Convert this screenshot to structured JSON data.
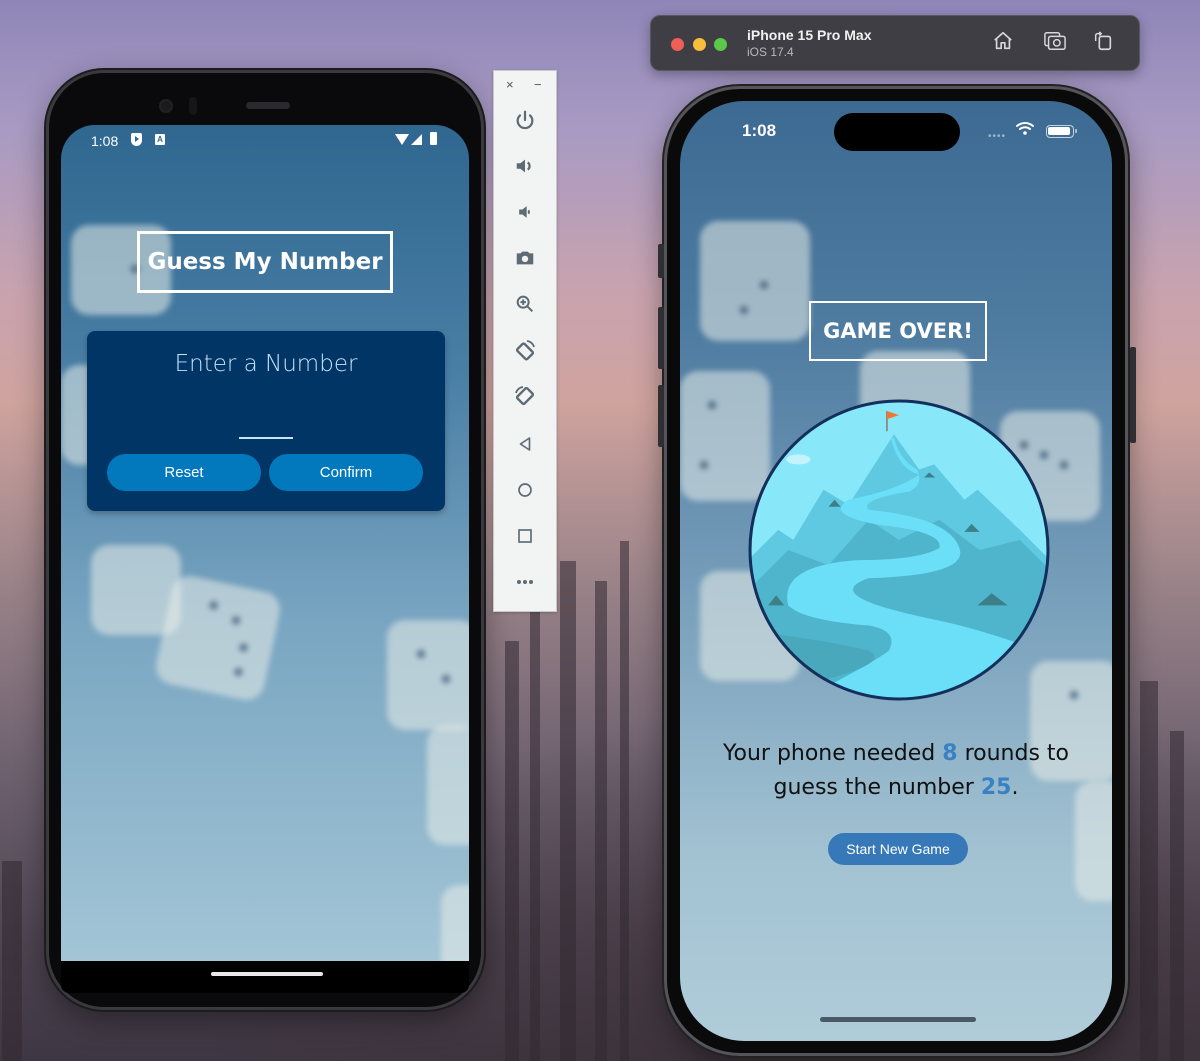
{
  "android_emulator": {
    "status_bar": {
      "time": "1:08",
      "left_icons": [
        "play-protect-icon",
        "keyboard-a-icon"
      ],
      "right_icons": [
        "wifi-icon",
        "signal-icon",
        "battery-icon"
      ],
      "a_glyph": "A"
    },
    "screen": {
      "title": "Guess My Number",
      "card": {
        "label": "Enter a Number",
        "input_value": "",
        "reset_label": "Reset",
        "confirm_label": "Confirm"
      }
    }
  },
  "emulator_toolbar": {
    "close_label": "×",
    "minimize_label": "−",
    "buttons": [
      {
        "name": "power-icon",
        "glyph": "⏻"
      },
      {
        "name": "volume-up-icon",
        "glyph": "🔊"
      },
      {
        "name": "volume-down-icon",
        "glyph": "🔉"
      },
      {
        "name": "camera-icon",
        "glyph": "📷"
      },
      {
        "name": "zoom-in-icon",
        "glyph": "🔍"
      },
      {
        "name": "rotate-left-icon",
        "glyph": "⟲"
      },
      {
        "name": "rotate-right-icon",
        "glyph": "⟳"
      },
      {
        "name": "back-icon",
        "glyph": "◁"
      },
      {
        "name": "home-icon",
        "glyph": "○"
      },
      {
        "name": "overview-icon",
        "glyph": "□"
      },
      {
        "name": "more-icon",
        "glyph": "•••"
      }
    ]
  },
  "ios_simulator": {
    "window": {
      "device_name": "iPhone 15 Pro Max",
      "os_version": "iOS 17.4",
      "home_glyph": "⌂",
      "screenshot_glyph": "⧉",
      "rotate_glyph": "↺"
    },
    "status_bar": {
      "time": "1:08",
      "dots": "••••",
      "wifi_glyph": "≋"
    },
    "screen": {
      "title": "GAME OVER!",
      "summary_prefix": "Your phone needed ",
      "rounds": "8",
      "summary_middle": " rounds to guess the number ",
      "number": "25",
      "summary_suffix": ".",
      "button_label": "Start New Game"
    }
  },
  "colors": {
    "card_bg": "#013566",
    "android_button": "#0279bc",
    "ios_button": "#3779b8",
    "highlight": "#3a80c4",
    "flag": "#f0772d"
  }
}
